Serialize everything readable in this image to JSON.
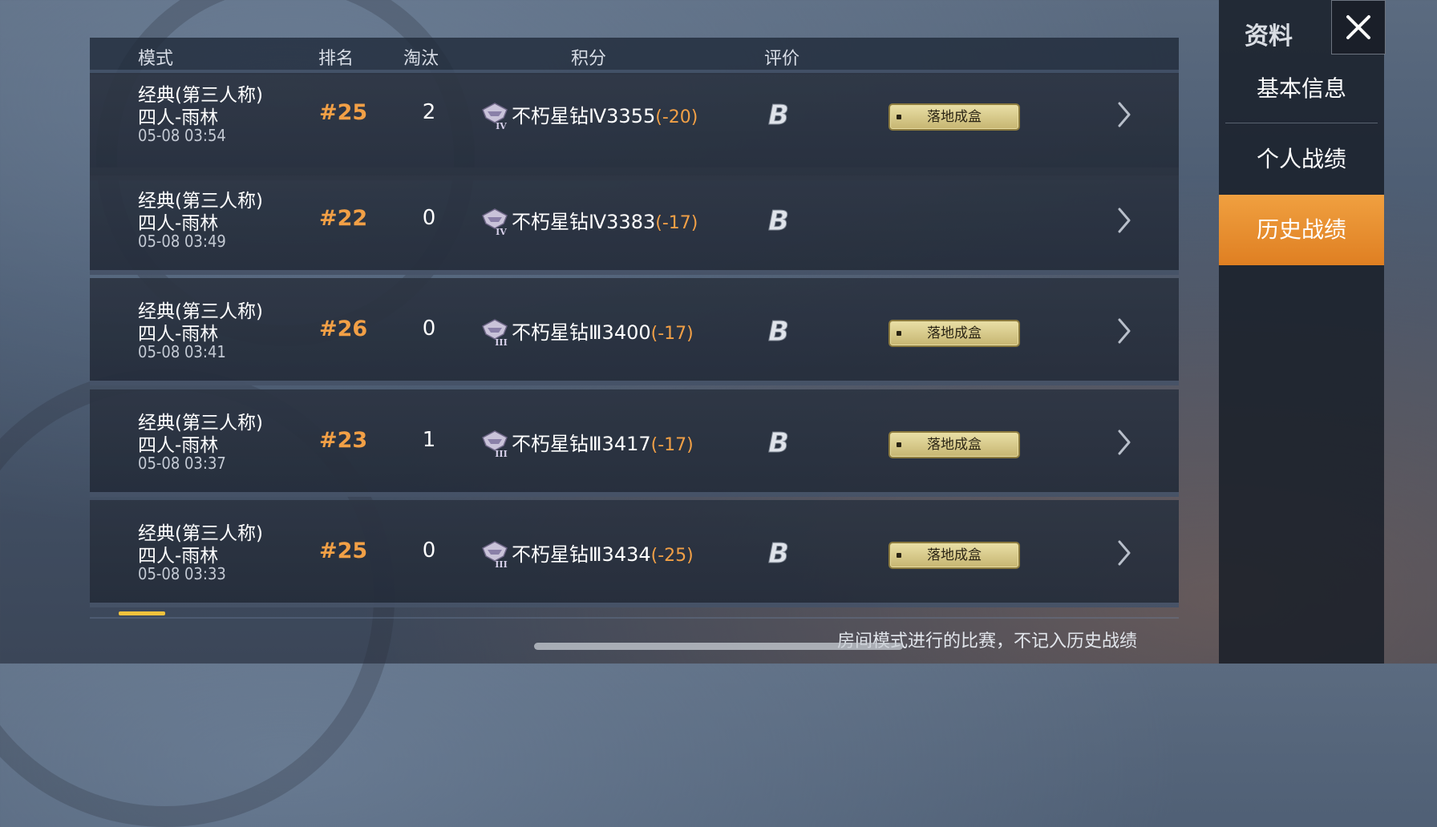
{
  "table": {
    "headers": {
      "mode": "模式",
      "rank": "排名",
      "elim": "淘汰",
      "score": "积分",
      "rating": "评价"
    },
    "rows": [
      {
        "mode_line1": "经典(第三人称)",
        "mode_line2": "四人-雨林",
        "time": "05-08 03:54",
        "rank": "#25",
        "eliminations": "2",
        "tier": "不朽星钻Ⅳ",
        "tier_numeral": "IV",
        "score": "3355",
        "delta": "(-20)",
        "rating": "B",
        "tag": "落地成盒"
      },
      {
        "mode_line1": "经典(第三人称)",
        "mode_line2": "四人-雨林",
        "time": "05-08 03:49",
        "rank": "#22",
        "eliminations": "0",
        "tier": "不朽星钻Ⅳ",
        "tier_numeral": "IV",
        "score": "3383",
        "delta": "(-17)",
        "rating": "B",
        "tag": ""
      },
      {
        "mode_line1": "经典(第三人称)",
        "mode_line2": "四人-雨林",
        "time": "05-08 03:41",
        "rank": "#26",
        "eliminations": "0",
        "tier": "不朽星钻Ⅲ",
        "tier_numeral": "III",
        "score": "3400",
        "delta": "(-17)",
        "rating": "B",
        "tag": "落地成盒"
      },
      {
        "mode_line1": "经典(第三人称)",
        "mode_line2": "四人-雨林",
        "time": "05-08 03:37",
        "rank": "#23",
        "eliminations": "1",
        "tier": "不朽星钻Ⅲ",
        "tier_numeral": "III",
        "score": "3417",
        "delta": "(-17)",
        "rating": "B",
        "tag": "落地成盒"
      },
      {
        "mode_line1": "经典(第三人称)",
        "mode_line2": "四人-雨林",
        "time": "05-08 03:33",
        "rank": "#25",
        "eliminations": "0",
        "tier": "不朽星钻Ⅲ",
        "tier_numeral": "III",
        "score": "3434",
        "delta": "(-25)",
        "rating": "B",
        "tag": "落地成盒"
      }
    ]
  },
  "footer_note": "房间模式进行的比赛，不记入历史战绩",
  "sidebar": {
    "title": "资料",
    "close_icon": "close-icon",
    "items": [
      {
        "label": "基本信息",
        "active": false
      },
      {
        "label": "个人战绩",
        "active": false
      },
      {
        "label": "历史战绩",
        "active": true
      }
    ]
  },
  "colors": {
    "accent": "#f2a046",
    "active_tab": "#e98a2c",
    "tag_bg": "#d8cb8a"
  }
}
